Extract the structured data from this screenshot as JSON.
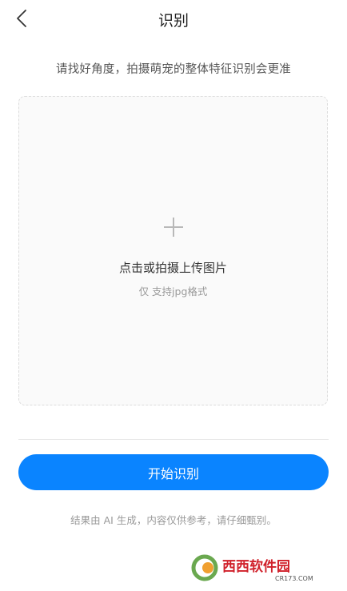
{
  "header": {
    "title": "识别",
    "back_icon": "chevron-left-icon"
  },
  "hint": "请找好角度，拍摄萌宠的整体特征识别会更准",
  "upload": {
    "icon": "plus-icon",
    "label": "点击或拍摄上传图片",
    "sub_label": "仅 支持jpg格式"
  },
  "actions": {
    "start_label": "开始识别"
  },
  "disclaimer": "结果由 AI 生成，内容仅供参考，请仔细甄别。",
  "watermark": {
    "brand": "西西软件园",
    "domain": "CR173.COM"
  },
  "colors": {
    "accent": "#0a84ff",
    "background": "#ffffff",
    "upload_bg": "#fafafa"
  }
}
